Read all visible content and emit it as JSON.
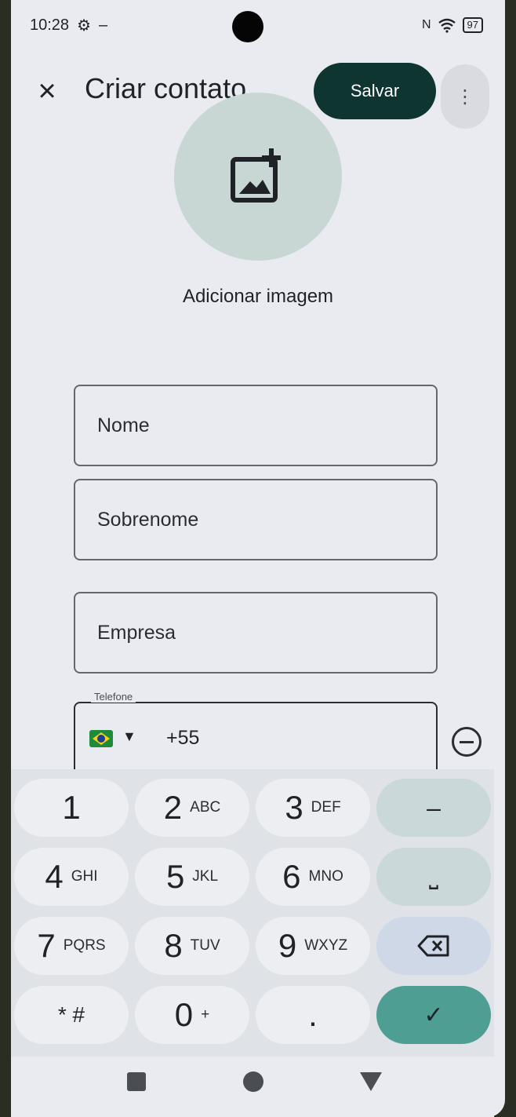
{
  "status_bar": {
    "time": "10:28",
    "battery": "97"
  },
  "app_bar": {
    "title": "Criar contato",
    "save_label": "Salvar",
    "close_glyph": "×",
    "menu_glyph": "⋮"
  },
  "photo": {
    "add_image_label": "Adicionar imagem"
  },
  "fields": {
    "first_name_placeholder": "Nome",
    "last_name_placeholder": "Sobrenome",
    "company_placeholder": "Empresa",
    "phone_label": "Telefone",
    "phone_prefix": "+55",
    "country": "Brasil"
  },
  "keypad": {
    "keys": [
      {
        "num": "1",
        "sub": ""
      },
      {
        "num": "2",
        "sub": "ABC"
      },
      {
        "num": "3",
        "sub": "DEF"
      },
      {
        "num": "4",
        "sub": "GHI"
      },
      {
        "num": "5",
        "sub": "JKL"
      },
      {
        "num": "6",
        "sub": "MNO"
      },
      {
        "num": "7",
        "sub": "PQRS"
      },
      {
        "num": "8",
        "sub": "TUV"
      },
      {
        "num": "9",
        "sub": "WXYZ"
      },
      {
        "num": "* #",
        "sub": ""
      },
      {
        "num": "0",
        "sub": "+"
      },
      {
        "num": ".",
        "sub": ""
      }
    ],
    "dash": "–",
    "space": "⎵",
    "done": "✓"
  },
  "colors": {
    "accent": "#0f3530",
    "done_key": "#4f9e94",
    "background": "#e9ebf0"
  },
  "icons": [
    "settings-icon",
    "nfc-icon",
    "wifi-icon",
    "battery-icon",
    "close-icon",
    "more-vert-icon",
    "add-image-icon",
    "brazil-flag-icon",
    "chevron-down-icon",
    "remove-circle-icon",
    "backspace-icon",
    "check-icon",
    "recents-icon",
    "home-icon",
    "back-icon"
  ]
}
